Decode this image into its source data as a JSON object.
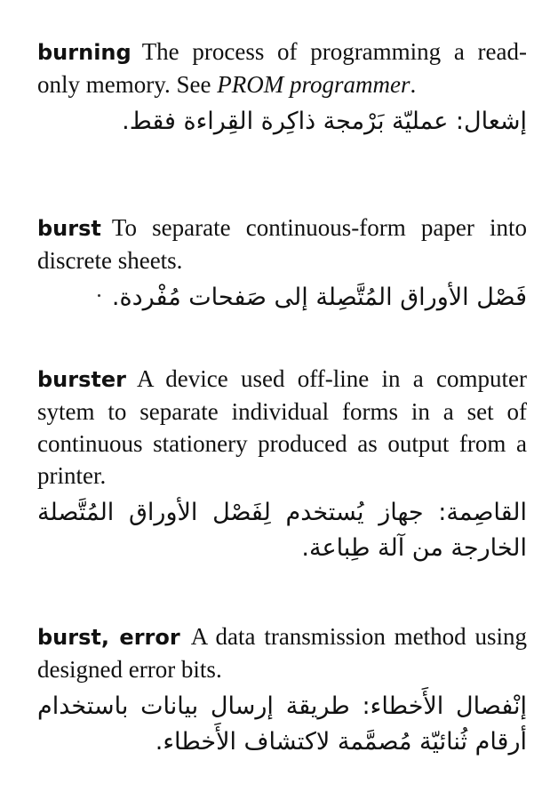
{
  "entries": [
    {
      "term": "burning",
      "definition_plain": "The process of programming a read-only memory. See",
      "definition_ref": "PROM programmer",
      "definition_end": ".",
      "arabic": "إشعال: عمليّة بَرْمجة ذاكِرة القِراءة فقط."
    },
    {
      "term": "burst",
      "definition_plain": "To separate continuous-form paper into discrete sheets.",
      "arabic": "فَصْل الأوراق المُتَّصِلة إلى صَفحات مُفْردة."
    },
    {
      "term": "burster",
      "definition_plain": "A device used off-line in a computer sytem to separate individual forms in a set of continuous stationery produced as output from a printer.",
      "arabic": "القاصِمة: جهاز يُستخدم لِفَصْل الأوراق المُتَّصلة الخارجة من آلة طِباعة."
    },
    {
      "term": "burst, error",
      "definition_plain": "A data transmission method using designed error bits.",
      "arabic": "إنْفصال الأَخطاء: طريقة إرسال بيانات باستخدام أرقام ثُنائيّة مُصمَّمة لاكتشاف الأَخطاء."
    }
  ]
}
